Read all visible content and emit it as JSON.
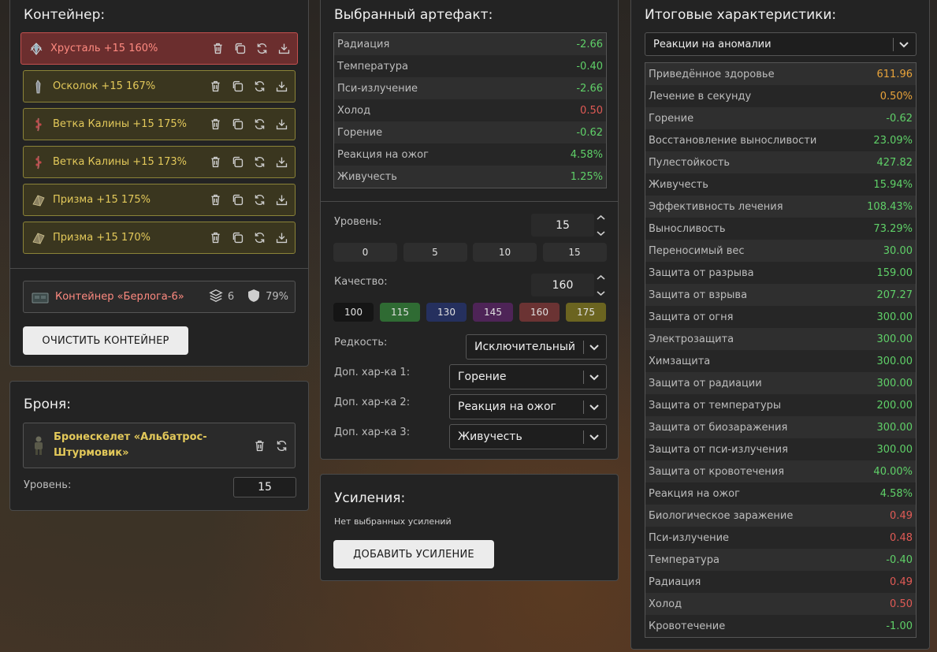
{
  "container": {
    "title": "Контейнер:",
    "items": [
      {
        "name": "Хрусталь +15 160%",
        "icon": "crystal-icon",
        "selected": true
      },
      {
        "name": "Осколок +15 167%",
        "icon": "shard-icon",
        "selected": false
      },
      {
        "name": "Ветка Калины +15 175%",
        "icon": "kalina-branch-icon",
        "selected": false
      },
      {
        "name": "Ветка Калины +15 173%",
        "icon": "kalina-branch-icon",
        "selected": false
      },
      {
        "name": "Призма +15 175%",
        "icon": "prism-icon",
        "selected": false
      },
      {
        "name": "Призма +15 170%",
        "icon": "prism-icon",
        "selected": false
      }
    ],
    "box": {
      "name": "Контейнер «Берлога-6»",
      "slots": "6",
      "protection": "79%"
    },
    "clear_button": "ОЧИСТИТЬ КОНТЕЙНЕР"
  },
  "armor": {
    "title": "Броня:",
    "name_line1": "Бронескелет «Альбатрос-",
    "name_line2": "Штурмовик»",
    "level_label": "Уровень:",
    "level_value": "15"
  },
  "artifact": {
    "title": "Выбранный артефакт:",
    "stats": [
      {
        "label": "Радиация",
        "value": "-2.66",
        "tone": "green"
      },
      {
        "label": "Температура",
        "value": "-0.40",
        "tone": "green"
      },
      {
        "label": "Пси-излучение",
        "value": "-2.66",
        "tone": "green"
      },
      {
        "label": "Холод",
        "value": "0.50",
        "tone": "red"
      },
      {
        "label": "Горение",
        "value": "-0.62",
        "tone": "green"
      },
      {
        "label": "Реакция на ожог",
        "value": "4.58%",
        "tone": "green"
      },
      {
        "label": "Живучесть",
        "value": "1.25%",
        "tone": "green"
      }
    ],
    "level_label": "Уровень:",
    "level_value": "15",
    "level_presets": [
      "0",
      "5",
      "10",
      "15"
    ],
    "quality_label": "Качество:",
    "quality_value": "160",
    "quality_presets": [
      {
        "label": "100",
        "color": "#151515"
      },
      {
        "label": "115",
        "color": "#2f6b33"
      },
      {
        "label": "130",
        "color": "#25305e"
      },
      {
        "label": "145",
        "color": "#4e2457"
      },
      {
        "label": "160",
        "color": "#6b3333"
      },
      {
        "label": "175",
        "color": "#6b6420"
      }
    ],
    "rarity_label": "Редкость:",
    "rarity_value": "Исключительный",
    "extra1_label": "Доп. хар-ка 1:",
    "extra1_value": "Горение",
    "extra2_label": "Доп. хар-ка 2:",
    "extra2_value": "Реакция на ожог",
    "extra3_label": "Доп. хар-ка 3:",
    "extra3_value": "Живучесть"
  },
  "boosts": {
    "title": "Усиления:",
    "empty_text": "Нет выбранных усилений",
    "add_button": "ДОБАВИТЬ УСИЛЕНИЕ"
  },
  "summary": {
    "title": "Итоговые характеристики:",
    "filter_value": "Реакции на аномалии",
    "stats": [
      {
        "label": "Приведённое здоровье",
        "value": "611.96",
        "tone": "orange"
      },
      {
        "label": "Лечение в секунду",
        "value": "0.50%",
        "tone": "orange"
      },
      {
        "label": "Горение",
        "value": "-0.62",
        "tone": "green"
      },
      {
        "label": "Восстановление выносливости",
        "value": "23.09%",
        "tone": "green"
      },
      {
        "label": "Пулестойкость",
        "value": "427.82",
        "tone": "green"
      },
      {
        "label": "Живучесть",
        "value": "15.94%",
        "tone": "green"
      },
      {
        "label": "Эффективность лечения",
        "value": "108.43%",
        "tone": "green"
      },
      {
        "label": "Выносливость",
        "value": "73.29%",
        "tone": "green"
      },
      {
        "label": "Переносимый вес",
        "value": "30.00",
        "tone": "green"
      },
      {
        "label": "Защита от разрыва",
        "value": "159.00",
        "tone": "green"
      },
      {
        "label": "Защита от взрыва",
        "value": "207.27",
        "tone": "green"
      },
      {
        "label": "Защита от огня",
        "value": "300.00",
        "tone": "green"
      },
      {
        "label": "Электрозащита",
        "value": "300.00",
        "tone": "green"
      },
      {
        "label": "Химзащита",
        "value": "300.00",
        "tone": "green"
      },
      {
        "label": "Защита от радиации",
        "value": "300.00",
        "tone": "green"
      },
      {
        "label": "Защита от температуры",
        "value": "200.00",
        "tone": "green"
      },
      {
        "label": "Защита от биозаражения",
        "value": "300.00",
        "tone": "green"
      },
      {
        "label": "Защита от пси-излучения",
        "value": "300.00",
        "tone": "green"
      },
      {
        "label": "Защита от кровотечения",
        "value": "40.00%",
        "tone": "green"
      },
      {
        "label": "Реакция на ожог",
        "value": "4.58%",
        "tone": "green"
      },
      {
        "label": "Биологическое заражение",
        "value": "0.49",
        "tone": "red"
      },
      {
        "label": "Пси-излучение",
        "value": "0.48",
        "tone": "red"
      },
      {
        "label": "Температура",
        "value": "-0.40",
        "tone": "green"
      },
      {
        "label": "Радиация",
        "value": "0.49",
        "tone": "red"
      },
      {
        "label": "Холод",
        "value": "0.50",
        "tone": "red"
      },
      {
        "label": "Кровотечение",
        "value": "-1.00",
        "tone": "green"
      }
    ]
  }
}
